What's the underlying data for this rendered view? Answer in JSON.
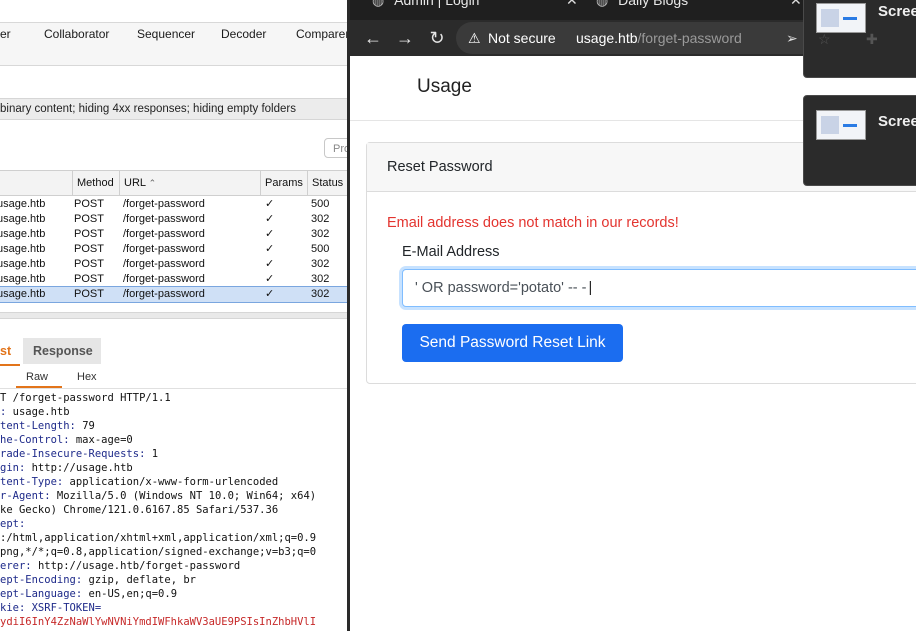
{
  "burp": {
    "tools": [
      "er",
      "Collaborator",
      "Sequencer",
      "Decoder",
      "Comparer"
    ],
    "filter_text": "binary content;  hiding 4xx responses;  hiding empty folders",
    "pro_button": "Pro",
    "columns": [
      "Method",
      "URL",
      "Params",
      "Status"
    ],
    "rows": [
      {
        "host": "usage.htb",
        "method": "POST",
        "url": "/forget-password",
        "params": "✓",
        "status": "500"
      },
      {
        "host": "usage.htb",
        "method": "POST",
        "url": "/forget-password",
        "params": "✓",
        "status": "302"
      },
      {
        "host": "usage.htb",
        "method": "POST",
        "url": "/forget-password",
        "params": "✓",
        "status": "302"
      },
      {
        "host": "usage.htb",
        "method": "POST",
        "url": "/forget-password",
        "params": "✓",
        "status": "500"
      },
      {
        "host": "usage.htb",
        "method": "POST",
        "url": "/forget-password",
        "params": "✓",
        "status": "302"
      },
      {
        "host": "usage.htb",
        "method": "POST",
        "url": "/forget-password",
        "params": "✓",
        "status": "302"
      },
      {
        "host": "usage.htb",
        "method": "POST",
        "url": "/forget-password",
        "params": "✓",
        "status": "302",
        "selected": true
      }
    ],
    "request_tab": "st",
    "response_tab": "Response",
    "subtabs": [
      "Raw",
      "Hex"
    ],
    "request_lines": [
      {
        "k": "",
        "v": "T /forget-password HTTP/1.1"
      },
      {
        "k": ": ",
        "v": "usage.htb"
      },
      {
        "k": "tent-Length: ",
        "v": "79"
      },
      {
        "k": "he-Control: ",
        "v": "max-age=0"
      },
      {
        "k": "rade-Insecure-Requests: ",
        "v": "1"
      },
      {
        "k": "gin: ",
        "v": "http://usage.htb"
      },
      {
        "k": "tent-Type: ",
        "v": "application/x-www-form-urlencoded"
      },
      {
        "k": "r-Agent: ",
        "v": "Mozilla/5.0 (Windows NT 10.0; Win64; x64)"
      },
      {
        "k": "",
        "v": "ke Gecko) Chrome/121.0.6167.85 Safari/537.36"
      },
      {
        "k": "ept:",
        "v": ""
      },
      {
        "k": "",
        "v": ":/html,application/xhtml+xml,application/xml;q=0.9"
      },
      {
        "k": "",
        "v": "png,*/*;q=0.8,application/signed-exchange;v=b3;q=0"
      },
      {
        "k": "erer: ",
        "v": "http://usage.htb/forget-password"
      },
      {
        "k": "ept-Encoding: ",
        "v": "gzip, deflate, br"
      },
      {
        "k": "ept-Language: ",
        "v": "en-US,en;q=0.9"
      },
      {
        "k": "kie: ",
        "v": "XSRF-TOKEN="
      },
      {
        "k": "",
        "v": "ydiI6InY4ZzNaWlYwNVNiYmdIWFhkaWV3aUE9PSIsInZhbHVlI"
      }
    ]
  },
  "chrome": {
    "tabs": [
      "Admin | Login",
      "Daily Blogs"
    ],
    "security_label": "Not secure",
    "url_host": "usage.htb",
    "url_path": "/forget-password"
  },
  "page": {
    "brand": "Usage",
    "card_title": "Reset Password",
    "error": "Email address does not match in our records!",
    "email_label": "E-Mail Address",
    "email_value": "' OR password='potato' -- -",
    "submit": "Send Password Reset Link"
  },
  "thumbnails": [
    {
      "title": "Scree"
    },
    {
      "title": "Scree"
    }
  ],
  "colors": {
    "error": "#e3342f",
    "button": "#1b6df0",
    "selection": "#cfe0f6",
    "burp_accent": "#e2741a"
  }
}
